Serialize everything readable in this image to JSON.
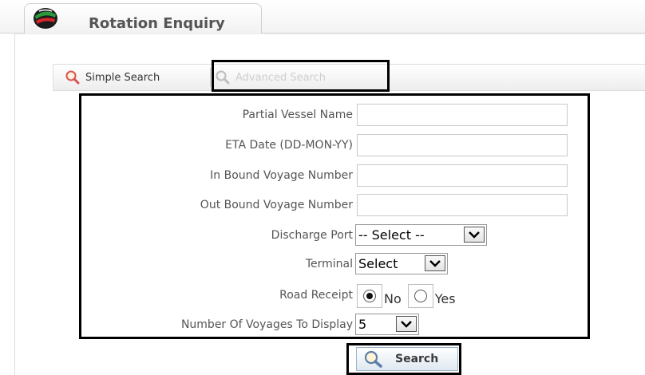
{
  "header": {
    "title": "Rotation Enquiry",
    "logo_icon": "globe-logo-icon"
  },
  "tabs": {
    "simple": {
      "label": "Simple Search",
      "icon": "search-icon"
    },
    "advanced": {
      "label": "Advanced Search",
      "icon": "search-icon"
    }
  },
  "form": {
    "vessel_name": {
      "label": "Partial Vessel Name",
      "value": ""
    },
    "eta_date": {
      "label": "ETA Date (DD-MON-YY)",
      "value": ""
    },
    "inbound_voyage": {
      "label": "In Bound Voyage Number",
      "value": ""
    },
    "outbound_voyage": {
      "label": "Out Bound Voyage Number",
      "value": ""
    },
    "discharge_port": {
      "label": "Discharge Port",
      "selected": "-- Select --"
    },
    "terminal": {
      "label": "Terminal",
      "selected": "Select"
    },
    "road_receipt": {
      "label": "Road Receipt",
      "options": [
        "No",
        "Yes"
      ],
      "selected": "No"
    },
    "num_voyages": {
      "label": "Number Of Voyages To Display",
      "selected": "5"
    }
  },
  "search_button": {
    "label": "Search",
    "icon": "search-icon"
  },
  "colors": {
    "highlight_border": "#000000",
    "disabled_tab": "#cfcfcf",
    "button_border": "#9bb3c9"
  }
}
